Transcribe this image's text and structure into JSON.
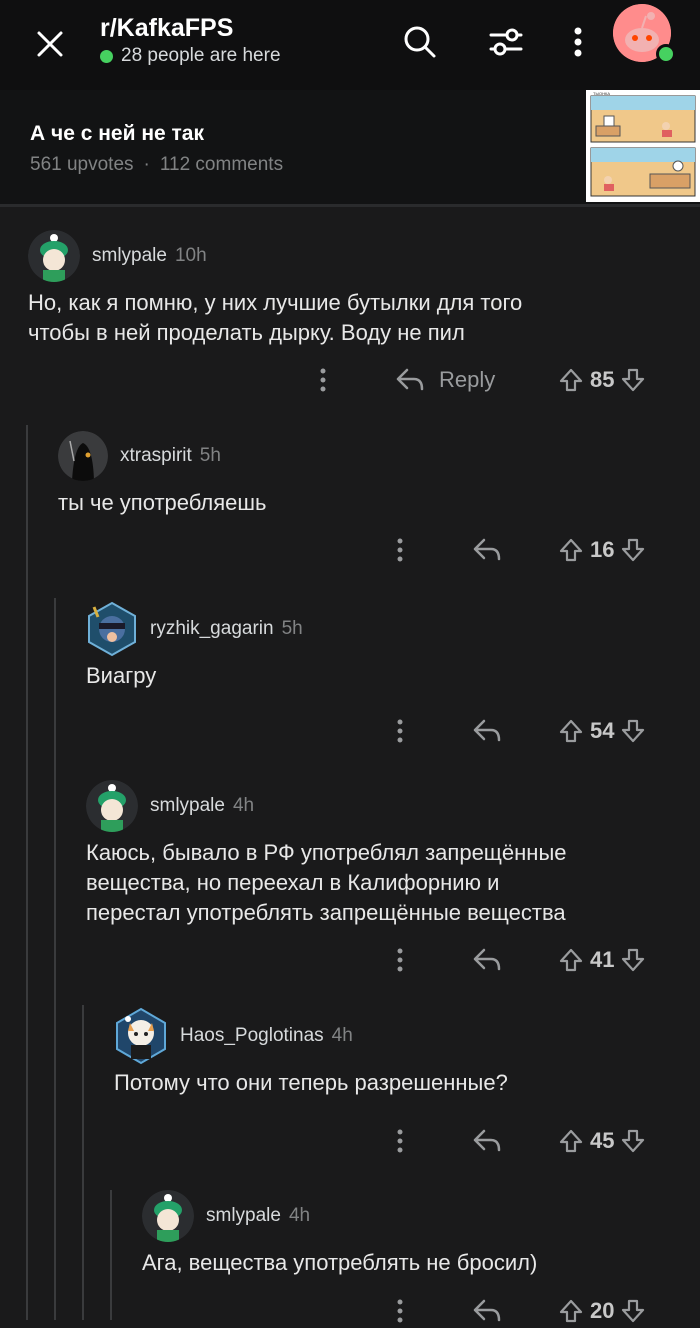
{
  "header": {
    "subreddit": "r/KafkaFPS",
    "online_text": "28 people are here"
  },
  "post": {
    "title": "А че с ней не так",
    "upvotes": "561 upvotes",
    "separator": "·",
    "comments": "112 comments",
    "thumb_caption": "ТЫОНКА"
  },
  "comments": [
    {
      "user": "smlypale",
      "time": "10h",
      "body": "Но, как я помню, у них лучшие бутылки для того\nчтобы в ней проделать дырку. Воду не пил",
      "reply_label": "Reply",
      "votes": "85"
    },
    {
      "user": "xtraspirit",
      "time": "5h",
      "body": "ты че употребляешь",
      "votes": "16"
    },
    {
      "user": "ryzhik_gagarin",
      "time": "5h",
      "body": "Виагру",
      "votes": "54"
    },
    {
      "user": "smlypale",
      "time": "4h",
      "body": "Каюсь, бывало в РФ употреблял запрещённые\nвещества, но переехал в Калифорнию и\nперестал употреблять запрещённые вещества",
      "votes": "41"
    },
    {
      "user": "Haos_Poglotinas",
      "time": "4h",
      "body": "Потому что они теперь разрешенные?",
      "votes": "45"
    },
    {
      "user": "smlypale",
      "time": "4h",
      "body": "Ага, вещества употреблять не бросил)",
      "votes": "20"
    }
  ],
  "colors": {
    "background": "#1a1a1b",
    "online": "#46d160",
    "muted": "#818384"
  }
}
